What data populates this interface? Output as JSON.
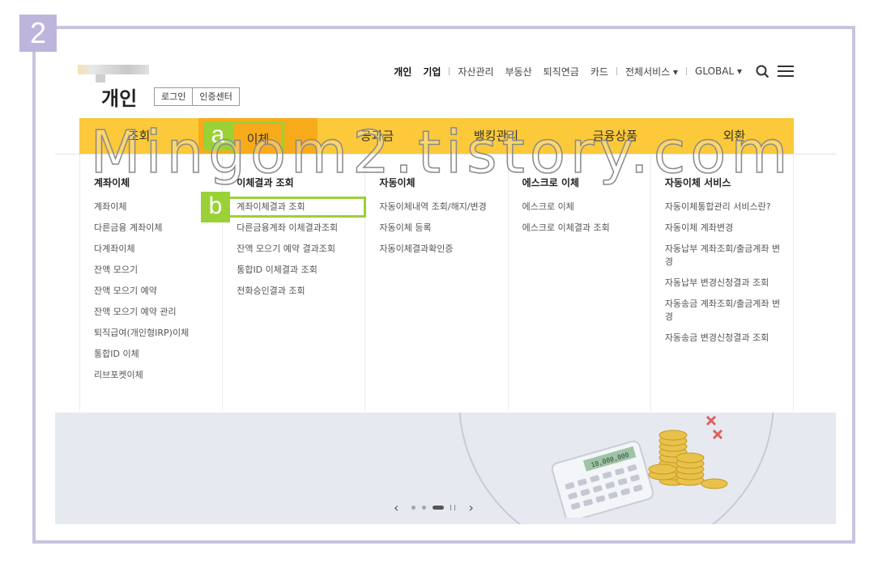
{
  "step_badge": "2",
  "header": {
    "title": "개인",
    "buttons": [
      "로그인",
      "인증센터"
    ]
  },
  "topnav": {
    "personal": "개인",
    "corporate": "기업",
    "asset": "자산관리",
    "realestate": "부동산",
    "pension": "퇴직연금",
    "card": "카드",
    "all_services": "전체서비스 ▾",
    "global": "GLOBAL ▾"
  },
  "gnb": [
    "조회",
    "이체",
    "공과금",
    "뱅킹관리",
    "금융상품",
    "외환"
  ],
  "mega_menu": [
    {
      "title": "계좌이체",
      "items": [
        "계좌이체",
        "다른금융 계좌이체",
        "다계좌이체",
        "잔액 모으기",
        "잔액 모으기 예약",
        "잔액 모으기 예약 관리",
        "퇴직급여(개인형IRP)이체",
        "통합ID 이체",
        "리브포켓이체"
      ]
    },
    {
      "title": "이체결과 조회",
      "items": [
        "계좌이체결과 조회",
        "다른금융계좌 이체결과조회",
        "잔액 모으기 예약 결과조회",
        "통합ID 이체결과 조회",
        "전화승인결과 조회"
      ]
    },
    {
      "title": "자동이체",
      "items": [
        "자동이체내역 조회/해지/변경",
        "자동이체 등록",
        "자동이체결과확인증"
      ]
    },
    {
      "title": "에스크로 이체",
      "items": [
        "에스크로 이체",
        "에스크로 이체결과 조회"
      ]
    },
    {
      "title": "자동이체 서비스",
      "items": [
        "자동이체통합관리 서비스란?",
        "자동이체 계좌변경",
        "자동납부 계좌조회/출금계좌 변경",
        "자동납부 변경신청결과 조회",
        "자동송금 계좌조회/출금계좌 변경",
        "자동송금 변경신청결과 조회"
      ]
    }
  ],
  "annotations": {
    "a": "a",
    "b": "b"
  },
  "banner": {
    "calculator_display": "10,000,000",
    "prev": "‹",
    "next": "›"
  },
  "watermark": "Mingom2.tistory.com",
  "colors": {
    "gnb": "#fbc93a",
    "gnb_active": "#f8ab1a",
    "highlight": "#9ad136",
    "frame": "#c9c3e0"
  }
}
